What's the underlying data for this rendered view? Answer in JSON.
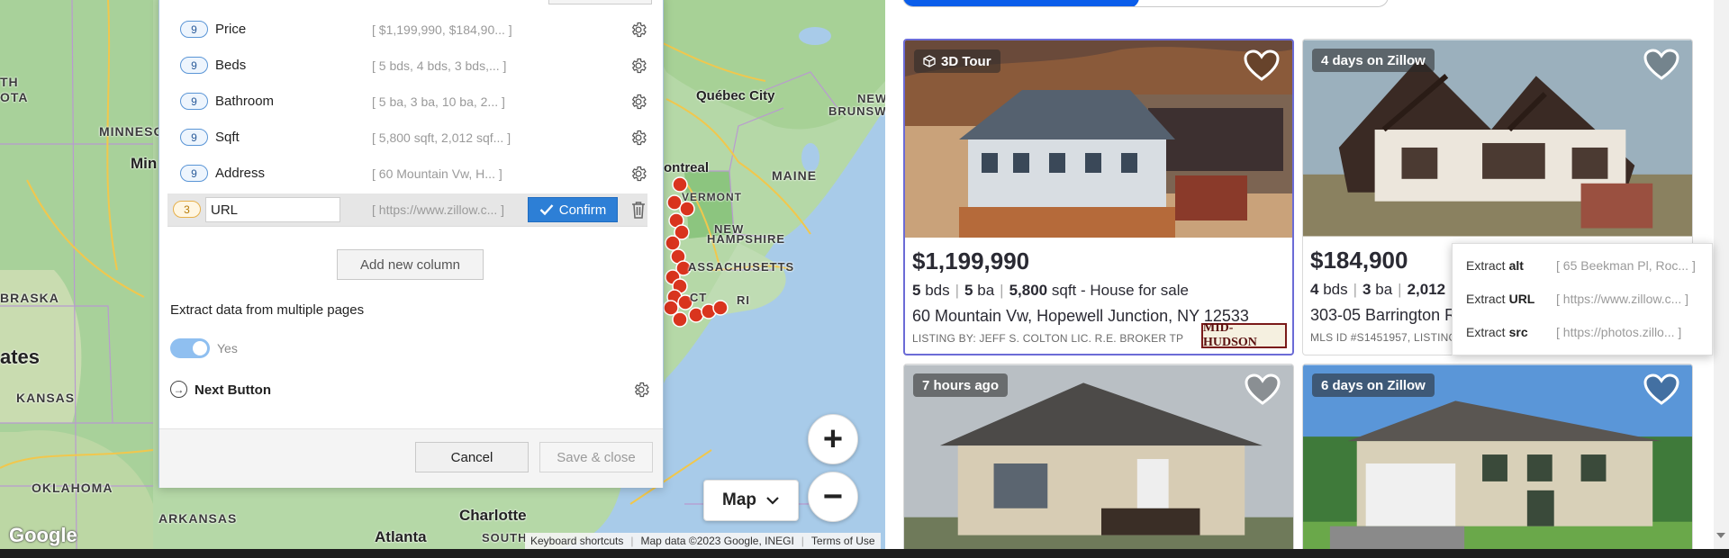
{
  "map": {
    "labels": {
      "quebec_city": "Québec City",
      "montreal": "ontreal",
      "vermont": "VERMONT",
      "maine": "MAINE",
      "new_hampshire_1": "NEW",
      "new_hampshire_2": "HAMPSHIRE",
      "massachusetts": "ASSACHUSETTS",
      "ri": "RI",
      "ct": "CT",
      "new_brunswick_1": "NEW",
      "new_brunswick_2": "BRUNSW",
      "minnesota": "MINNESO",
      "min": "Min",
      "north": "TH",
      "dakota": "OTA",
      "nebraska": "BRASKA",
      "states": "ates",
      "kansas": "KANSAS",
      "oklahoma": "OKLAHOMA",
      "arkansas": "ARKANSAS",
      "charlotte": "Charlotte",
      "atlanta": "Atlanta",
      "south": "SOUTH"
    },
    "map_type": "Map",
    "zoom_in": "+",
    "zoom_out": "−",
    "google_logo": "Google",
    "footer": {
      "keyboard": "Keyboard shortcuts",
      "data": "Map data ©2023 Google, INEGI",
      "terms": "Terms of Use"
    }
  },
  "panel": {
    "columns": [
      {
        "count": "9",
        "name": "Price",
        "preview": "[ $1,199,990, $184,90... ]"
      },
      {
        "count": "9",
        "name": "Beds",
        "preview": "[ 5 bds, 4 bds, 3 bds,... ]"
      },
      {
        "count": "9",
        "name": "Bathroom",
        "preview": "[ 5 ba, 3 ba, 10 ba, 2... ]"
      },
      {
        "count": "9",
        "name": "Sqft",
        "preview": "[ 5,800 sqft, 2,012 sqf... ]"
      },
      {
        "count": "9",
        "name": "Address",
        "preview": "[ 60 Mountain Vw, H... ]"
      }
    ],
    "editing": {
      "count": "3",
      "name": "URL",
      "preview": "[ https://www.zillow.c... ]"
    },
    "confirm_label": "Confirm",
    "add_column_label": "Add new column",
    "multi_page_label": "Extract data from multiple pages",
    "toggle_label": "Yes",
    "next_button_label": "Next Button",
    "cancel_label": "Cancel",
    "save_close_label": "Save & close"
  },
  "listings": [
    {
      "badge": "3D Tour",
      "price": "$1,199,990",
      "beds": "5",
      "beds_unit": "bds",
      "baths": "5",
      "baths_unit": "ba",
      "sqft": "5,800",
      "sqft_unit": "sqft - House for sale",
      "address": "60 Mountain Vw, Hopewell Junction, NY 12533",
      "broker": "LISTING BY: JEFF S. COLTON LIC. R.E. BROKER TP",
      "logo": "MID-HUDSON"
    },
    {
      "badge": "4 days on Zillow",
      "price": "$184,900",
      "beds": "4",
      "beds_unit": "bds",
      "baths": "3",
      "baths_unit": "ba",
      "sqft": "2,012",
      "sqft_unit": "",
      "address": "303-05 Barrington R",
      "broker": "MLS ID #S1451957, LISTING"
    },
    {
      "badge": "7 hours ago"
    },
    {
      "badge": "6 days on Zillow"
    }
  ],
  "extract_popup": [
    {
      "verb": "Extract",
      "attr": "alt",
      "value": "[ 65 Beekman Pl, Roc... ]"
    },
    {
      "verb": "Extract",
      "attr": "URL",
      "value": "[ https://www.zillow.c... ]"
    },
    {
      "verb": "Extract",
      "attr": "src",
      "value": "[ https://photos.zillo... ]"
    }
  ],
  "colors": {
    "accent": "#2d7fd6",
    "zillow_blue": "#0a5dea",
    "map_marker": "#d9341e",
    "map_land": "#b9dcae",
    "map_water": "#a8cbe9"
  }
}
